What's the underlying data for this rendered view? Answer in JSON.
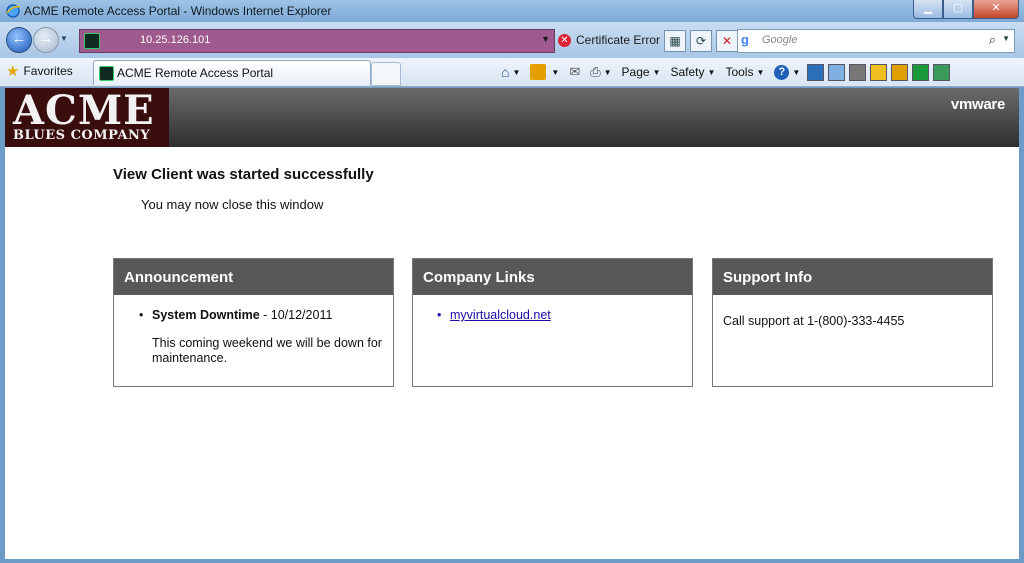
{
  "window": {
    "title": "ACME Remote Access Portal - Windows Internet Explorer"
  },
  "address_bar": {
    "url": "10.25.126.101",
    "cert_error": "Certificate Error"
  },
  "search": {
    "placeholder": "Google"
  },
  "favorites_bar": {
    "favorites_label": "Favorites",
    "tab_label": "ACME Remote Access Portal"
  },
  "command_bar": {
    "page": "Page",
    "safety": "Safety",
    "tools": "Tools"
  },
  "header": {
    "logo_big": "ACME",
    "logo_small": "BLUES COMPANY",
    "vmware": "vmware"
  },
  "main": {
    "heading": "View Client was started successfully",
    "subtext": "You may now close this window"
  },
  "panels": {
    "announcement": {
      "title": "Announcement",
      "item_title": "System Downtime",
      "item_date": " - 10/12/2011",
      "item_text": "This coming weekend we will be down for maintenance."
    },
    "company_links": {
      "title": "Company Links",
      "link": "myvirtualcloud.net"
    },
    "support": {
      "title": "Support Info",
      "text": "Call support at 1-(800)-333-4455"
    }
  },
  "colors": {
    "header_dark": "#2e2e2e",
    "panel_header": "#585858",
    "link": "#1a0dab",
    "address_bg": "#9e5a8e"
  }
}
